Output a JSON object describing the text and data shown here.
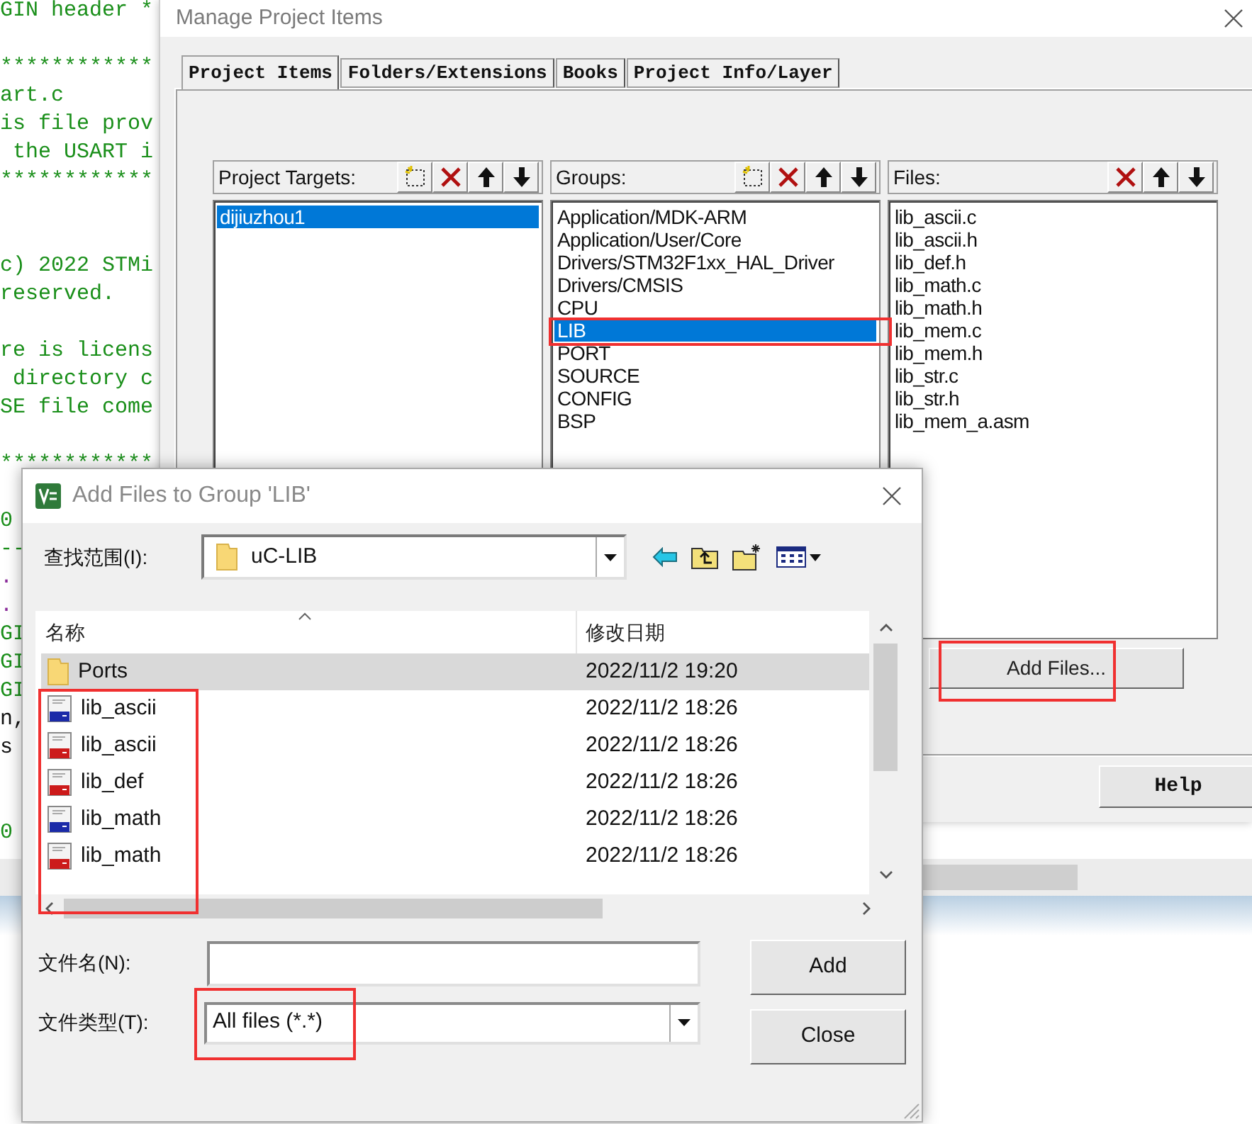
{
  "editor": {
    "lines": [
      {
        "kind": "comment",
        "text": "GIN header *"
      },
      {
        "kind": "blank"
      },
      {
        "kind": "comment",
        "text": "************"
      },
      {
        "kind": "comment",
        "text": "art.c"
      },
      {
        "kind": "comment",
        "text": "is file prov"
      },
      {
        "kind": "comment",
        "text": " the USART i"
      },
      {
        "kind": "comment",
        "text": "************"
      },
      {
        "kind": "blank"
      },
      {
        "kind": "blank"
      },
      {
        "kind": "comment",
        "text": "c) 2022 STMi"
      },
      {
        "kind": "comment",
        "text": "reserved."
      },
      {
        "kind": "blank"
      },
      {
        "kind": "comment",
        "text": "re is licens"
      },
      {
        "kind": "comment",
        "text": " directory c"
      },
      {
        "kind": "comment",
        "text": "SE file come"
      },
      {
        "kind": "blank"
      },
      {
        "kind": "comment",
        "text": "************"
      },
      {
        "kind": "blank"
      },
      {
        "kind": "comment",
        "text": "0"
      },
      {
        "kind": "comment",
        "text": "--"
      },
      {
        "kind": "include",
        "text": "."
      },
      {
        "kind": "include",
        "text": "."
      },
      {
        "kind": "comment",
        "text": "GI"
      },
      {
        "kind": "comment",
        "text": "GI"
      },
      {
        "kind": "comment",
        "text": "GI"
      },
      {
        "kind": "code",
        "text": "n,"
      },
      {
        "kind": "code",
        "text": "s"
      },
      {
        "kind": "blank"
      },
      {
        "kind": "blank"
      },
      {
        "kind": "comment",
        "text": "0"
      }
    ]
  },
  "manage_dialog": {
    "title": "Manage Project Items",
    "tabs": [
      {
        "label": "Project Items",
        "selected": true
      },
      {
        "label": "Folders/Extensions",
        "selected": false
      },
      {
        "label": "Books",
        "selected": false
      },
      {
        "label": "Project Info/Layer",
        "selected": false
      }
    ],
    "targets": {
      "label": "Project Targets:",
      "items": [
        {
          "text": "dijiuzhou1",
          "selected": true
        }
      ]
    },
    "groups": {
      "label": "Groups:",
      "items": [
        {
          "text": "Application/MDK-ARM",
          "selected": false,
          "highlighted": false
        },
        {
          "text": "Application/User/Core",
          "selected": false,
          "highlighted": false
        },
        {
          "text": "Drivers/STM32F1xx_HAL_Driver",
          "selected": false,
          "highlighted": false
        },
        {
          "text": "Drivers/CMSIS",
          "selected": false,
          "highlighted": false
        },
        {
          "text": "CPU",
          "selected": false,
          "highlighted": false
        },
        {
          "text": "LIB",
          "selected": true,
          "highlighted": true
        },
        {
          "text": "PORT",
          "selected": false,
          "highlighted": false
        },
        {
          "text": "SOURCE",
          "selected": false,
          "highlighted": false
        },
        {
          "text": "CONFIG",
          "selected": false,
          "highlighted": false
        },
        {
          "text": "BSP",
          "selected": false,
          "highlighted": false
        }
      ]
    },
    "files": {
      "label": "Files:",
      "items": [
        {
          "text": "lib_ascii.c"
        },
        {
          "text": "lib_ascii.h"
        },
        {
          "text": "lib_def.h"
        },
        {
          "text": "lib_math.c"
        },
        {
          "text": "lib_math.h"
        },
        {
          "text": "lib_mem.c"
        },
        {
          "text": "lib_mem.h"
        },
        {
          "text": "lib_str.c"
        },
        {
          "text": "lib_str.h"
        },
        {
          "text": "lib_mem_a.asm"
        }
      ]
    },
    "add_files_button": {
      "label": "Add Files...",
      "highlighted": true
    },
    "help_button": {
      "label": "Help"
    }
  },
  "add_dialog": {
    "title": "Add Files to Group 'LIB'",
    "look_in_label": "查找范围(I):",
    "look_in_value": "uC-LIB",
    "columns": [
      "名称",
      "修改日期"
    ],
    "rows": [
      {
        "kind": "folder",
        "name": "Ports",
        "date": "2022/11/2 19:20",
        "selected": true
      },
      {
        "kind": "c",
        "name": "lib_ascii",
        "date": "2022/11/2 18:26",
        "selected": false
      },
      {
        "kind": "h",
        "name": "lib_ascii",
        "date": "2022/11/2 18:26",
        "selected": false
      },
      {
        "kind": "h",
        "name": "lib_def",
        "date": "2022/11/2 18:26",
        "selected": false
      },
      {
        "kind": "c",
        "name": "lib_math",
        "date": "2022/11/2 18:26",
        "selected": false
      },
      {
        "kind": "h",
        "name": "lib_math",
        "date": "2022/11/2 18:26",
        "selected": false
      }
    ],
    "names_highlighted": true,
    "file_name_label": "文件名(N):",
    "file_type_label": "文件类型(T):",
    "file_type_value": "All files (*.*)",
    "file_type_highlighted": true,
    "buttons": [
      {
        "label": "Add"
      },
      {
        "label": "Close"
      }
    ]
  }
}
